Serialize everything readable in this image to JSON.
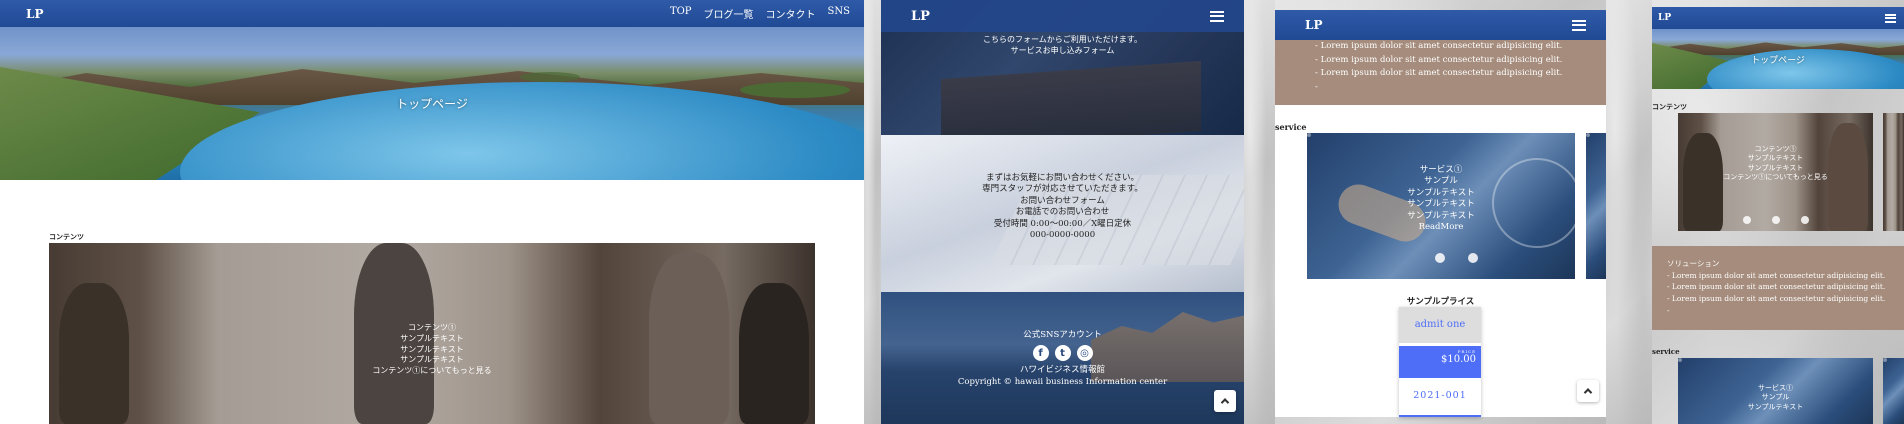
{
  "colors": {
    "nav": "#2a539e",
    "tan": "#a58c7c",
    "price_blue": "#4f6ef7",
    "marble": "#d6d6d6"
  },
  "p1": {
    "logo": "LP",
    "nav": [
      "TOP",
      "ブログ一覧",
      "コンタクト",
      "SNS"
    ],
    "hero_title": "トップページ",
    "section_label": "コンテンツ",
    "card_lines": [
      "コンテンツ①",
      "サンプルテキスト",
      "サンプルテキスト",
      "サンプルテキスト",
      "コンテンツ①についてもっと見る"
    ]
  },
  "p2": {
    "logo": "LP",
    "top_lines": [
      "こちらのフォームからご利用いただけます。",
      "サービスお申し込みフォーム"
    ],
    "contact_lines": [
      "まずはお気軽にお問い合わせください。",
      "専門スタッフが対応させていただきます。",
      "お問い合わせフォーム",
      "お電話でのお問い合わせ",
      "受付時間 0:00〜00:00／X曜日定休",
      "000-0000-0000"
    ],
    "sns_title": "公式SNSアカウント",
    "sns_icons": [
      "facebook-icon",
      "twitter-icon",
      "instagram-icon"
    ],
    "company": "ハワイビジネス情報館",
    "copyright": "Copyright © hawaii business Information center"
  },
  "p3": {
    "logo": "LP",
    "list": [
      "- Lorem ipsum dolor sit amet consectetur adipisicing elit.",
      "- Lorem ipsum dolor sit amet consectetur adipisicing elit.",
      "- Lorem ipsum dolor sit amet consectetur adipisicing elit.",
      "-"
    ],
    "section_label": "service",
    "card_lines": [
      "サービス①",
      "サンプル",
      "サンプルテキスト",
      "サンプルテキスト",
      "サンプルテキスト",
      "ReadMore"
    ],
    "price_title": "サンプルプライス",
    "price_name": "admit one",
    "price_small": "PRICE",
    "price_value": "$10.00",
    "price_date": "2021-001"
  },
  "p4": {
    "logo": "LP",
    "hero_title": "トップページ",
    "section_label": "コンテンツ",
    "card_lines": [
      "コンテンツ①",
      "サンプルテキスト",
      "サンプルテキスト",
      "コンテンツ①についてもっと見る"
    ],
    "solution_title": "ソリューション",
    "list": [
      "- Lorem ipsum dolor sit amet consectetur adipisicing elit.",
      "- Lorem ipsum dolor sit amet consectetur adipisicing elit.",
      "- Lorem ipsum dolor sit amet consectetur adipisicing elit.",
      "-"
    ],
    "service_label": "service",
    "service_lines": [
      "サービス①",
      "サンプル",
      "サンプルテキスト"
    ]
  }
}
